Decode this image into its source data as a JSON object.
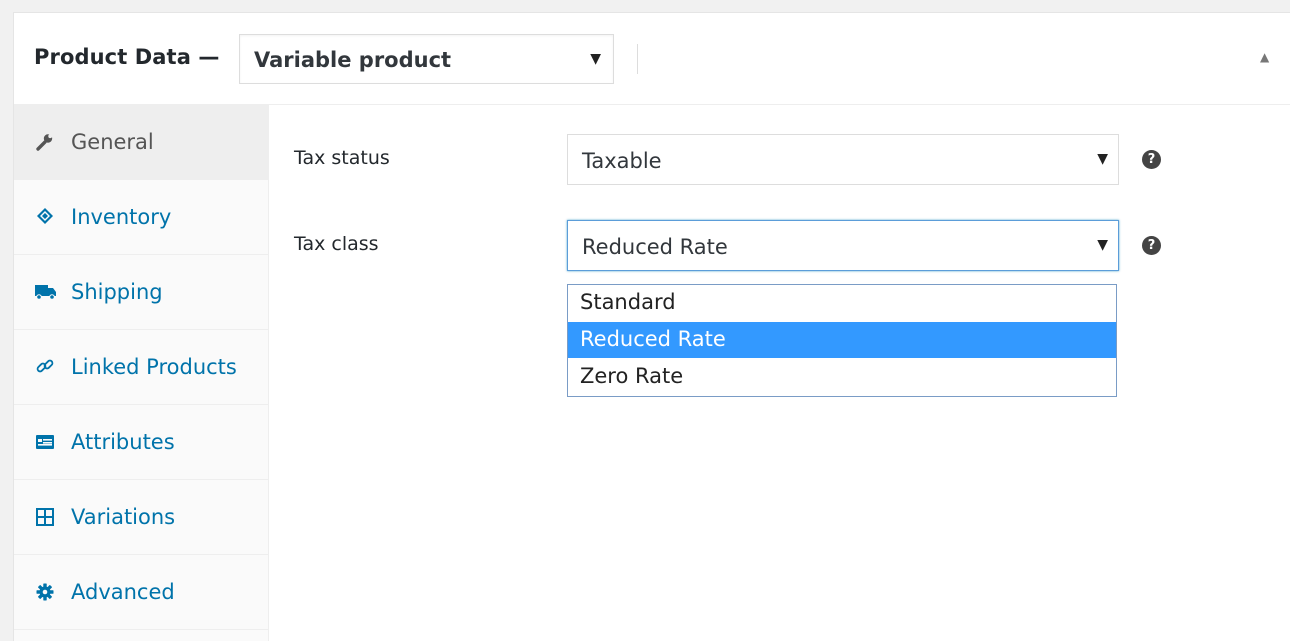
{
  "header": {
    "title": "Product Data",
    "dash": "—",
    "product_type": "Variable product"
  },
  "sidebar": {
    "items": [
      {
        "label": "General",
        "icon": "wrench-icon",
        "active": true
      },
      {
        "label": "Inventory",
        "icon": "tag-icon",
        "active": false
      },
      {
        "label": "Shipping",
        "icon": "truck-icon",
        "active": false
      },
      {
        "label": "Linked Products",
        "icon": "link-icon",
        "active": false
      },
      {
        "label": "Attributes",
        "icon": "list-card-icon",
        "active": false
      },
      {
        "label": "Variations",
        "icon": "grid-icon",
        "active": false
      },
      {
        "label": "Advanced",
        "icon": "gear-icon",
        "active": false
      }
    ]
  },
  "fields": {
    "tax_status": {
      "label": "Tax status",
      "value": "Taxable"
    },
    "tax_class": {
      "label": "Tax class",
      "value": "Reduced Rate"
    }
  },
  "dropdown": {
    "options": [
      "Standard",
      "Reduced Rate",
      "Zero Rate"
    ],
    "selected": "Reduced Rate"
  },
  "help_glyph": "?",
  "arrow_glyph": "▼",
  "collapse_glyph": "▲",
  "colors": {
    "link": "#0073aa",
    "highlight": "#3399ff",
    "active_tab_bg": "#eeeeee"
  }
}
